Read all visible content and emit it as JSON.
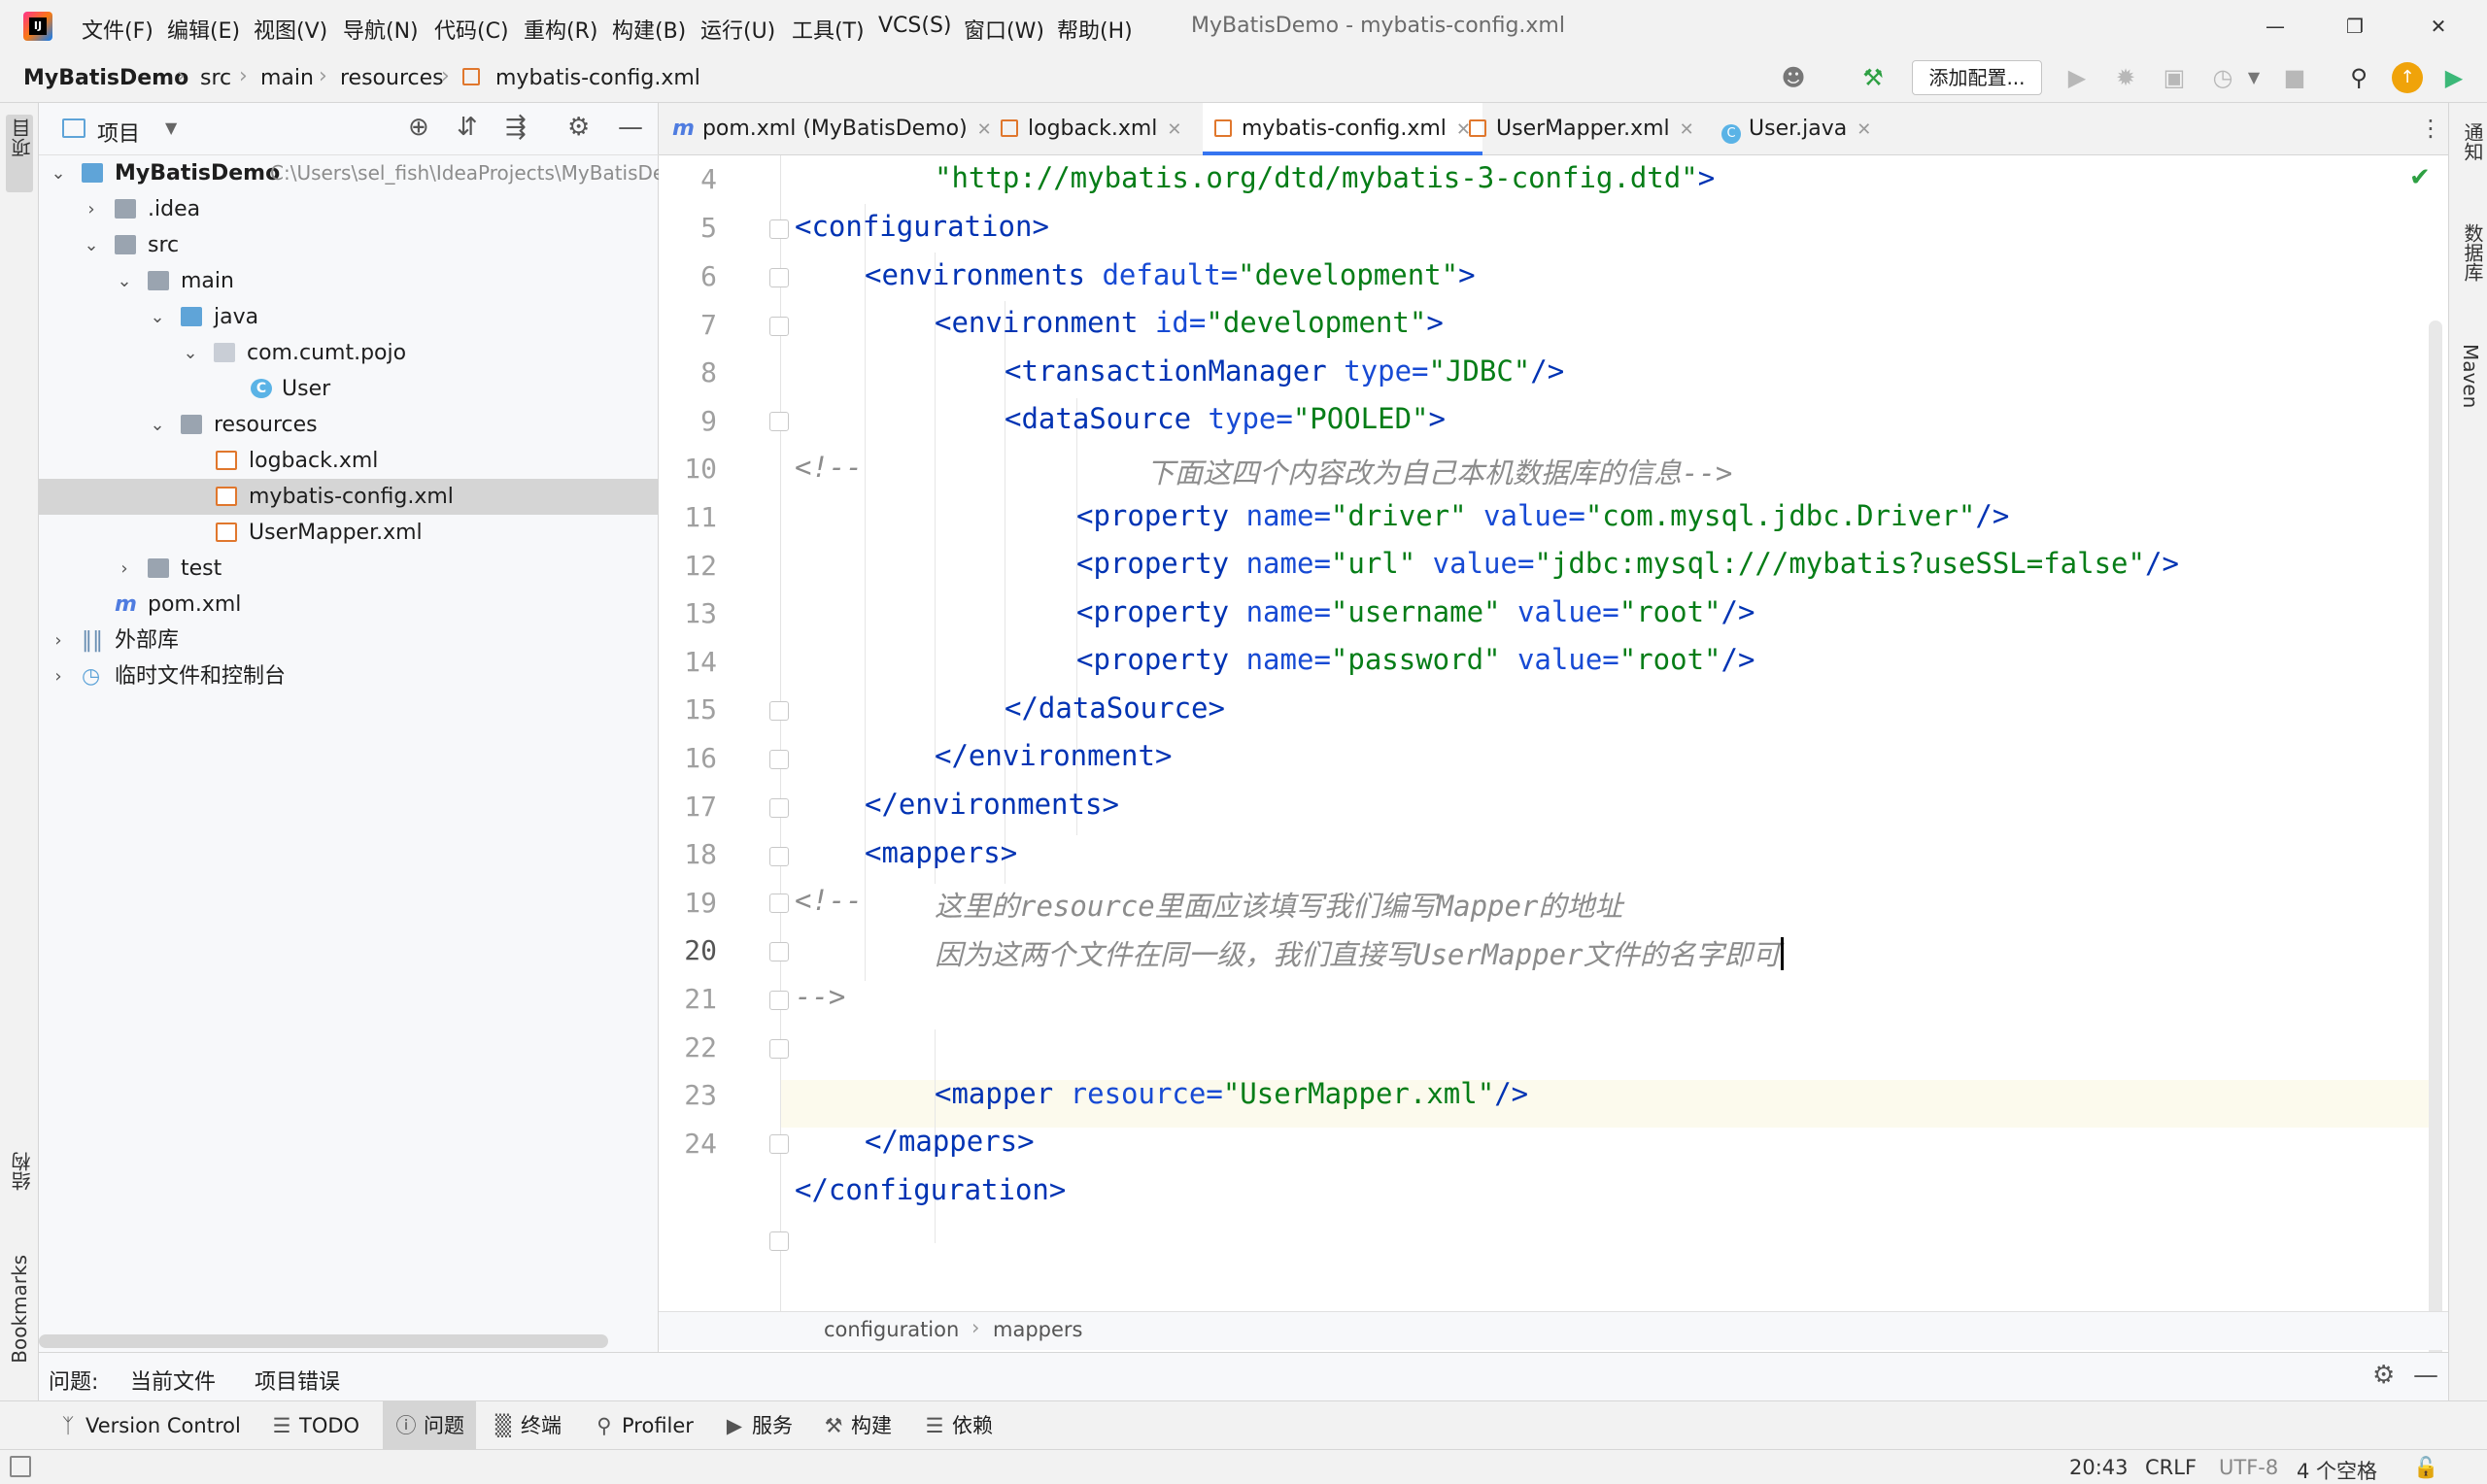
{
  "menubar": {
    "items": [
      "文件(F)",
      "编辑(E)",
      "视图(V)",
      "导航(N)",
      "代码(C)",
      "重构(R)",
      "构建(B)",
      "运行(U)",
      "工具(T)",
      "VCS(S)",
      "窗口(W)",
      "帮助(H)"
    ],
    "window_title": "MyBatisDemo - mybatis-config.xml"
  },
  "navbar": {
    "crumbs": [
      "MyBatisDemo",
      "src",
      "main",
      "resources",
      "mybatis-config.xml"
    ],
    "run_config_label": "添加配置..."
  },
  "left_strip": {
    "project": "项目",
    "structure": "结构",
    "bookmarks": "Bookmarks"
  },
  "right_strip": {
    "notifications": "通知",
    "database": "数据库",
    "maven": "Maven"
  },
  "project_panel": {
    "title": "项目",
    "tree": [
      {
        "label": "MyBatisDemo",
        "path": "C:\\Users\\sel_fish\\IdeaProjects\\MyBatisDemo"
      },
      {
        "label": ".idea"
      },
      {
        "label": "src"
      },
      {
        "label": "main"
      },
      {
        "label": "java"
      },
      {
        "label": "com.cumt.pojo"
      },
      {
        "label": "User"
      },
      {
        "label": "resources"
      },
      {
        "label": "logback.xml"
      },
      {
        "label": "mybatis-config.xml"
      },
      {
        "label": "UserMapper.xml"
      },
      {
        "label": "test"
      },
      {
        "label": "pom.xml"
      },
      {
        "label": "外部库"
      },
      {
        "label": "临时文件和控制台"
      }
    ]
  },
  "editor_tabs": [
    {
      "label": "pom.xml (MyBatisDemo)",
      "icon": "maven-icon"
    },
    {
      "label": "logback.xml",
      "icon": "xml-icon"
    },
    {
      "label": "mybatis-config.xml",
      "icon": "xml-icon"
    },
    {
      "label": "UserMapper.xml",
      "icon": "xml-icon"
    },
    {
      "label": "User.java",
      "icon": "class-icon"
    }
  ],
  "editor": {
    "line_numbers": [
      "4",
      "5",
      "6",
      "7",
      "8",
      "9",
      "10",
      "11",
      "12",
      "13",
      "14",
      "15",
      "16",
      "17",
      "18",
      "19",
      "20",
      "21",
      "22",
      "23",
      "24"
    ],
    "lines": {
      "l4": {
        "s1": "\"http://mybatis.org/dtd/mybatis-3-config.dtd\"",
        "p1": ">"
      },
      "l5": {
        "t1": "<configuration",
        "p1": ">"
      },
      "l6": {
        "t1": "<environments",
        "a1": " default=",
        "s1": "\"development\"",
        "p1": ">"
      },
      "l7": {
        "t1": "<environment",
        "a1": " id=",
        "s1": "\"development\"",
        "p1": ">"
      },
      "l8": {
        "t1": "<transactionManager",
        "a1": " type=",
        "s1": "\"JDBC\"",
        "p1": "/>"
      },
      "l9": {
        "t1": "<dataSource",
        "a1": " type=",
        "s1": "\"POOLED\"",
        "p1": ">"
      },
      "l10": {
        "c1": "<!--",
        "c2": "下面这四个内容改为自己本机数据库的信息-->"
      },
      "l11": {
        "t1": "<property",
        "a1": " name=",
        "s1": "\"driver\"",
        "a2": " value=",
        "s2": "\"com.mysql.jdbc.Driver\"",
        "p1": "/>"
      },
      "l12": {
        "t1": "<property",
        "a1": " name=",
        "s1": "\"url\"",
        "a2": " value=",
        "s2": "\"jdbc:mysql:///mybatis?useSSL=false\"",
        "p1": "/>"
      },
      "l13": {
        "t1": "<property",
        "a1": " name=",
        "s1": "\"username\"",
        "a2": " value=",
        "s2": "\"root\"",
        "p1": "/>"
      },
      "l14": {
        "t1": "<property",
        "a1": " name=",
        "s1": "\"password\"",
        "a2": " value=",
        "s2": "\"root\"",
        "p1": "/>"
      },
      "l15": {
        "t1": "</dataSource",
        "p1": ">"
      },
      "l16": {
        "t1": "</environment",
        "p1": ">"
      },
      "l17": {
        "t1": "</environments",
        "p1": ">"
      },
      "l18": {
        "t1": "<mappers",
        "p1": ">"
      },
      "l19": {
        "c1": "<!--",
        "c2": "这里的resource里面应该填写我们编写Mapper的地址"
      },
      "l20": {
        "c2": "因为这两个文件在同一级，我们直接写UserMapper文件的名字即可"
      },
      "l21": {
        "c1": "-->"
      },
      "l22": {
        "t1": "<mapper",
        "a1": " resource=",
        "s1": "\"UserMapper.xml\"",
        "p1": "/>"
      },
      "l23": {
        "t1": "</mappers",
        "p1": ">"
      },
      "l24": {
        "t1": "</configuration",
        "p1": ">"
      }
    },
    "breadcrumb": [
      "configuration",
      "mappers"
    ]
  },
  "problems": {
    "label": "问题:",
    "tabs": [
      "当前文件",
      "项目错误"
    ]
  },
  "bottom_tabs": [
    "Version Control",
    "TODO",
    "问题",
    "终端",
    "Profiler",
    "服务",
    "构建",
    "依赖"
  ],
  "status": {
    "position": "20:43",
    "line_sep": "CRLF",
    "encoding": "UTF-8",
    "indent": "4 个空格"
  }
}
